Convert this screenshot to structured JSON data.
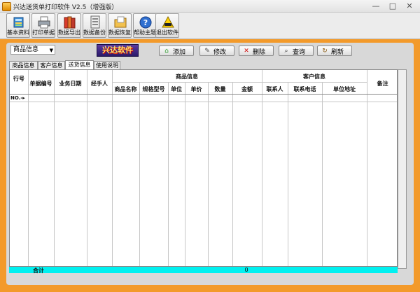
{
  "window": {
    "title": "兴达送货单打印软件 V2.5（增强版）",
    "minimize": "—",
    "maximize": "□",
    "close": "✕"
  },
  "toolbar": {
    "buttons": [
      {
        "label": "基本资料",
        "icon": "database-icon"
      },
      {
        "label": "打印单据",
        "icon": "printer-icon"
      },
      {
        "label": "数据导出",
        "icon": "books-icon"
      },
      {
        "label": "数据备份",
        "icon": "backup-icon"
      },
      {
        "label": "数据恢复",
        "icon": "restore-folder-icon"
      },
      {
        "label": "帮助主题",
        "icon": "help-icon"
      },
      {
        "label": "退出软件",
        "icon": "exit-icon"
      }
    ]
  },
  "module_select": {
    "value": "商品信息"
  },
  "logo_text": "兴达软件",
  "actions": {
    "add": "添加",
    "edit": "修改",
    "delete": "删除",
    "query": "查询",
    "refresh": "刷新"
  },
  "tabs": [
    "商品信息",
    "客户信息",
    "送货信息",
    "使用说明"
  ],
  "active_tab": 2,
  "table": {
    "columns": {
      "row_no": "行号",
      "bill_no": "单据编号",
      "biz_date": "业务日期",
      "handler": "经手人",
      "goods_group": "商品信息",
      "goods_name": "商品名称",
      "spec": "规格型号",
      "unit": "单位",
      "price": "单价",
      "qty": "数量",
      "amount": "金额",
      "customer_group": "客户信息",
      "contact": "联系人",
      "phone": "联系电话",
      "address": "单位地址",
      "remark": "备注"
    },
    "new_row_marker": "NO.-▸",
    "total_label": "合计",
    "total_amount": "0"
  },
  "colors": {
    "frame": "#f39a2a",
    "total_bar": "#00f0f0",
    "logo_bg": "#3a2280"
  }
}
